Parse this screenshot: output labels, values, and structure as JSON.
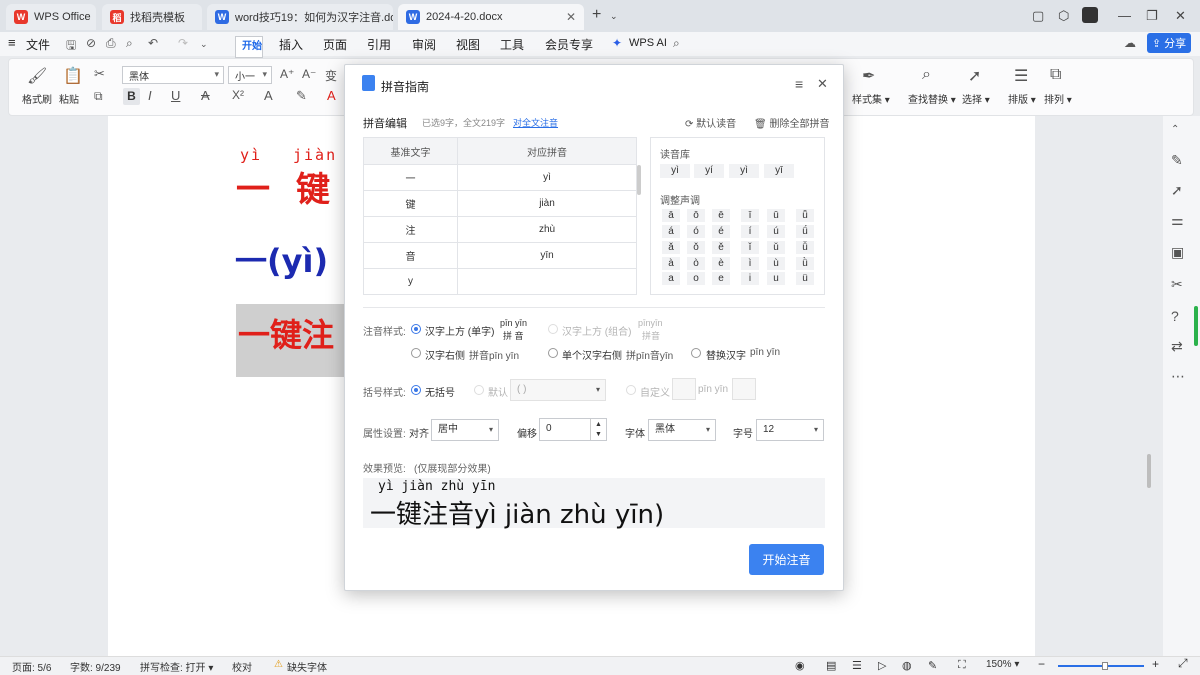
{
  "tabs": [
    {
      "label": "WPS Office"
    },
    {
      "label": "找稻壳模板"
    },
    {
      "label": "word技巧19：如何为汉字注音.do"
    },
    {
      "label": "2024-4-20.docx"
    }
  ],
  "menu": {
    "file": "文件",
    "items": [
      "开始",
      "插入",
      "页面",
      "引用",
      "审阅",
      "视图",
      "工具",
      "会员专享"
    ],
    "wps_ai": "WPS AI",
    "share": "分享"
  },
  "ribbon": {
    "format_painter": "格式刷",
    "paste": "粘贴",
    "font_name": "黑体",
    "font_size": "小一",
    "style_set": "样式集",
    "find_replace": "查找替换",
    "select": "选择",
    "layout": "排版",
    "arrange": "排列"
  },
  "document": {
    "line1_pinyin_1": "yì",
    "line1_pinyin_2": "jiàn",
    "line1_hanzi_1": "一",
    "line1_hanzi_2": "键",
    "line2": "一(yì)",
    "line3": "一键注"
  },
  "dialog": {
    "title": "拼音指南",
    "section_edit": "拼音编辑",
    "selected_info": "已选9字，全文219字",
    "full_text_link": "对全文注音",
    "default_reading": "默认读音",
    "delete_all": "删除全部拼音",
    "table_headers": [
      "基准文字",
      "对应拼音"
    ],
    "table_rows": [
      {
        "base": "一",
        "pinyin": "yì"
      },
      {
        "base": "键",
        "pinyin": "jiàn"
      },
      {
        "base": "注",
        "pinyin": "zhù"
      },
      {
        "base": "音",
        "pinyin": "yīn"
      },
      {
        "base": "y",
        "pinyin": ""
      }
    ],
    "reading_lib_label": "读音库",
    "reading_lib": [
      "yì",
      "yí",
      "yì",
      "yī"
    ],
    "tone_label": "调整声调",
    "tones": [
      [
        "ā",
        "ō",
        "ē",
        "ī",
        "ū",
        "ǖ"
      ],
      [
        "á",
        "ó",
        "é",
        "í",
        "ú",
        "ǘ"
      ],
      [
        "ǎ",
        "ǒ",
        "ě",
        "ǐ",
        "ǔ",
        "ǚ"
      ],
      [
        "à",
        "ò",
        "è",
        "ì",
        "ù",
        "ǜ"
      ],
      [
        "a",
        "o",
        "e",
        "i",
        "u",
        "ü"
      ]
    ],
    "style_label": "注音样式:",
    "opt_above_single": "汉字上方 (单字)",
    "sample_above_single_py": "pīn yīn",
    "sample_above_single_hz": "拼  音",
    "opt_above_combo": "汉字上方 (组合)",
    "sample_above_combo_py": "pīnyīn",
    "sample_above_combo_hz": "拼音",
    "opt_right": "汉字右侧",
    "sample_right": "拼音pīn yīn",
    "opt_single_right": "单个汉字右侧",
    "sample_single_right": "拼pīn音yīn",
    "opt_replace": "替换汉字",
    "sample_replace": "pīn yīn",
    "bracket_label": "括号样式:",
    "opt_no_bracket": "无括号",
    "opt_default": "默认",
    "bracket_default_value": "( )",
    "opt_custom": "自定义",
    "sample_custom": "pīn yīn",
    "prop_label": "属性设置:",
    "align_label": "对齐",
    "align_value": "居中",
    "offset_label": "偏移",
    "offset_value": "0",
    "font_label": "字体",
    "font_value": "黑体",
    "size_label": "字号",
    "size_value": "12",
    "preview_label": "效果预览:",
    "preview_note": "(仅展现部分效果)",
    "preview_pinyin": "yì jiàn zhù yīn",
    "preview_text": "一键注音yì  jiàn  zhù  yīn)",
    "start_button": "开始注音"
  },
  "status": {
    "page": "页面: 5/6",
    "words": "字数: 9/239",
    "spell": "拼写检查: 打开",
    "proof": "校对",
    "missing_font": "缺失字体",
    "zoom": "150%"
  },
  "colors": {
    "accent": "#1a66e8",
    "doc_red": "#e0201a",
    "doc_blue": "#1c2ab0",
    "button_blue": "#3b82f0"
  }
}
